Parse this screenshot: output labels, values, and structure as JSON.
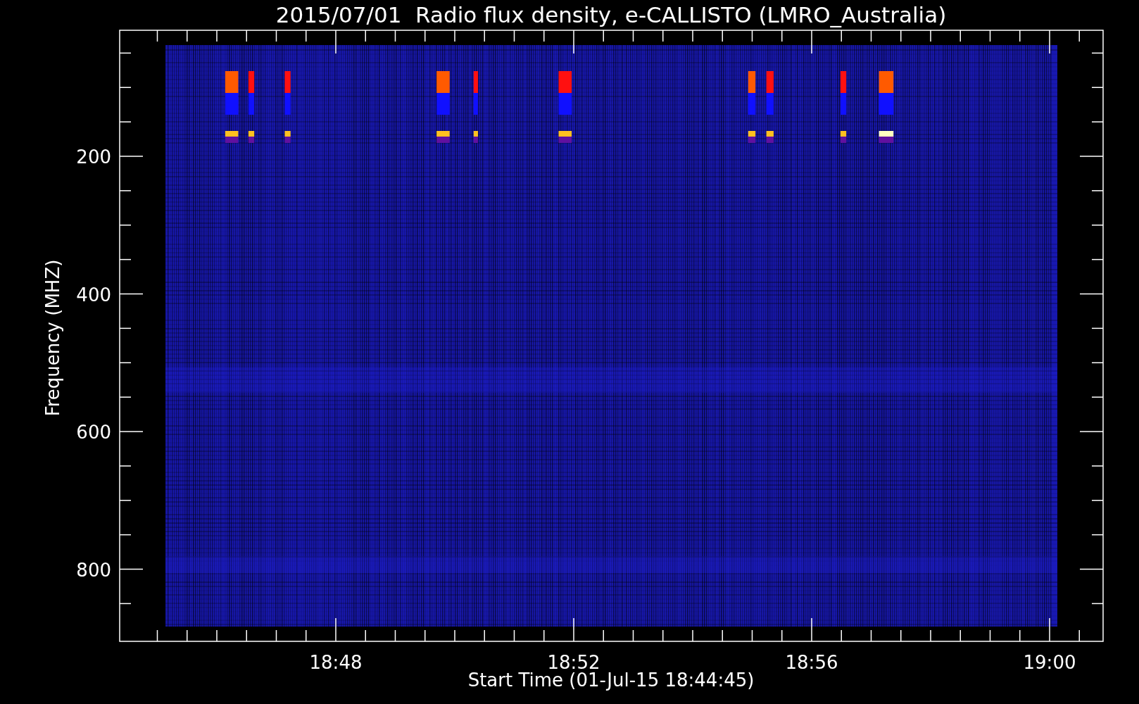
{
  "title": "2015/07/01  Radio flux density, e-CALLISTO (LMRO_Australia)",
  "ylabel": "Frequency (MHZ)",
  "xlabel": "Start Time (01-Jul-15 18:44:45)",
  "yticks": [
    "200",
    "400",
    "600",
    "800"
  ],
  "xticks": [
    "18:48",
    "18:52",
    "18:56",
    "19:00"
  ]
}
